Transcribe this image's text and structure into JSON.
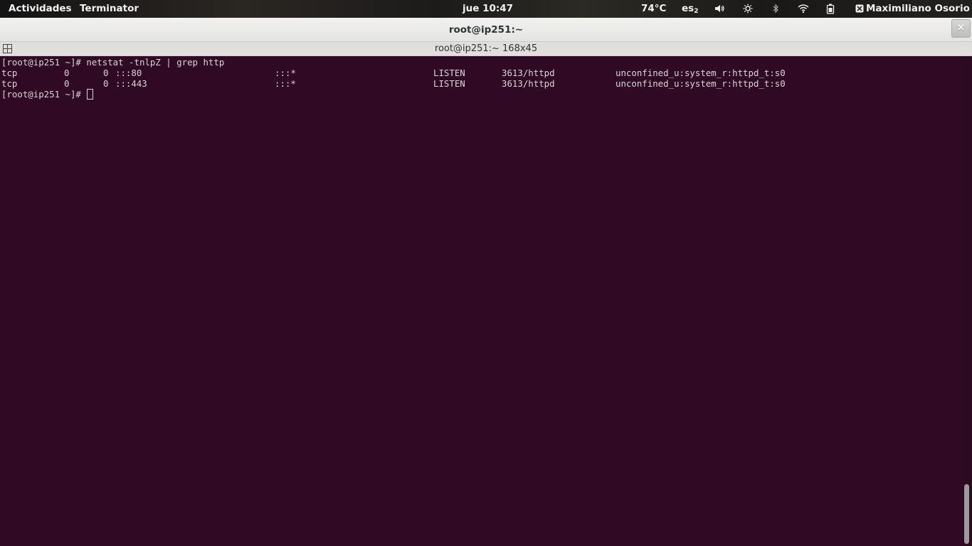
{
  "topbar": {
    "activities_label": "Actividades",
    "app_menu_label": "Terminator",
    "clock": "jue 10:47",
    "temperature": "74°C",
    "keyboard_layout": "es",
    "keyboard_layout_index": "2",
    "user_name": "Maximiliano Osorio",
    "icons": [
      "volume-icon",
      "brightness-icon",
      "bluetooth-icon",
      "wifi-icon",
      "battery-icon",
      "user-icon"
    ]
  },
  "window": {
    "title": "root@ip251:~",
    "close_label": "×"
  },
  "terminal_header": {
    "title": "root@ip251:~ 168x45"
  },
  "terminal": {
    "colors": {
      "background": "#300a24",
      "foreground": "#d6d6d6"
    },
    "command_line": "[root@ip251 ~]# netstat -tnlpZ | grep http",
    "rows": [
      {
        "proto": "tcp",
        "recv_q": "0",
        "send_q": "0",
        "local_address": ":::80",
        "foreign_address": ":::*",
        "state": "LISTEN",
        "pid_program": "3613/httpd",
        "security_context": "unconfined_u:system_r:httpd_t:s0"
      },
      {
        "proto": "tcp",
        "recv_q": "0",
        "send_q": "0",
        "local_address": ":::443",
        "foreign_address": ":::*",
        "state": "LISTEN",
        "pid_program": "3613/httpd",
        "security_context": "unconfined_u:system_r:httpd_t:s0"
      }
    ],
    "prompt": "[root@ip251 ~]# "
  }
}
